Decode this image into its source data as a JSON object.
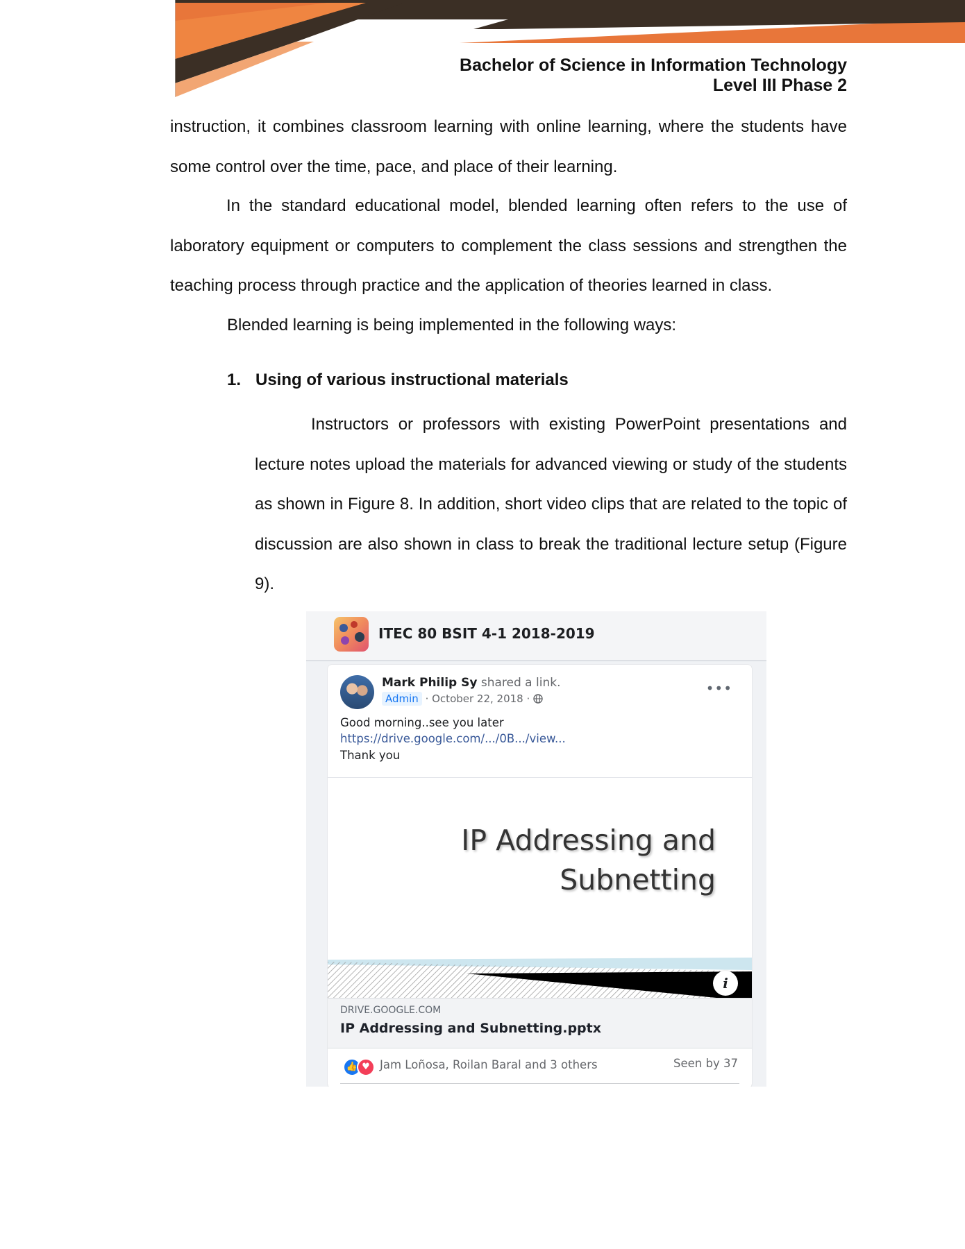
{
  "header": {
    "program": "Bachelor of Science in Information Technology",
    "level": "Level III Phase 2",
    "colors": {
      "orange": "#e8763a",
      "dark": "#3b2f25"
    }
  },
  "body": {
    "p1": "instruction, it combines classroom learning with online learning, where the students have some control over the time, pace, and place of their learning.",
    "p2": "In the standard educational model, blended learning often refers to the use of laboratory equipment or computers to complement the class sessions and strengthen the teaching process through practice and the application of theories learned in class.",
    "p3": "Blended learning is being implemented in the following ways:",
    "heading_num": "1.",
    "heading_text": "Using of various instructional materials",
    "p4": "Instructors or professors with existing PowerPoint presentations and lecture notes upload the materials for advanced viewing or study of the students as shown in Figure 8. In addition, short video clips that are related to the topic of discussion are also shown in class to break the traditional lecture setup (Figure 9)."
  },
  "figure": {
    "group_name": "ITEC 80 BSIT 4-1 2018-2019",
    "poster_name": "Mark Philip Sy",
    "poster_action": "shared a link.",
    "admin_badge": "Admin",
    "date": "· October 22, 2018 ·",
    "privacy_icon": "globe-icon",
    "more_icon": "•••",
    "message_line1": "Good morning..see you later",
    "message_link": "https://drive.google.com/.../0B.../view...",
    "message_line3": "Thank you",
    "slide_title_line1": "IP Addressing and",
    "slide_title_line2": "Subnetting",
    "info_icon": "i",
    "link_domain": "DRIVE.GOOGLE.COM",
    "link_title": "IP Addressing and Subnetting.pptx",
    "reactors": "Jam Loñosa, Roilan Baral and 3 others",
    "seen_by": "Seen by 37",
    "like_glyph": "👍",
    "love_glyph": "♥"
  }
}
